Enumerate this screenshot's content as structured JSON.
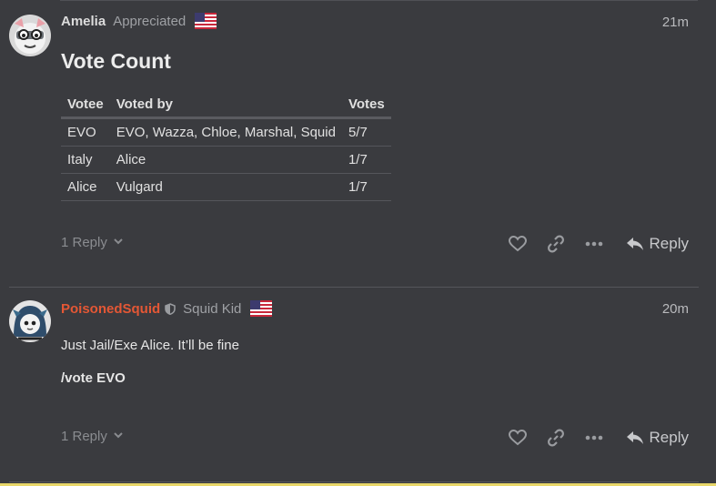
{
  "posts": [
    {
      "username": "Amelia",
      "user_title": "Appreciated",
      "time": "21m",
      "heading": "Vote Count",
      "table": {
        "headers": [
          "Votee",
          "Voted by",
          "Votes"
        ],
        "rows": [
          [
            "EVO",
            "EVO, Wazza, Chloe, Marshal, Squid",
            "5/7"
          ],
          [
            "Italy",
            "Alice",
            "1/7"
          ],
          [
            "Alice",
            "Vulgard",
            "1/7"
          ]
        ]
      },
      "replies_label": "1 Reply",
      "reply_label": "Reply"
    },
    {
      "username": "PoisonedSquid",
      "user_title": "Squid Kid",
      "time": "20m",
      "lines": [
        "Just Jail/Exe Alice. It’ll be fine",
        "/vote EVO"
      ],
      "replies_label": "1 Reply",
      "reply_label": "Reply"
    }
  ],
  "colors": {
    "background": "#3a3b3f",
    "username_highlight": "#e45735",
    "muted": "#8a8c90"
  },
  "icons": [
    "heart-icon",
    "link-icon",
    "more-icon",
    "reply-icon",
    "chevron-down-icon",
    "shield-icon",
    "us-flag-icon"
  ]
}
